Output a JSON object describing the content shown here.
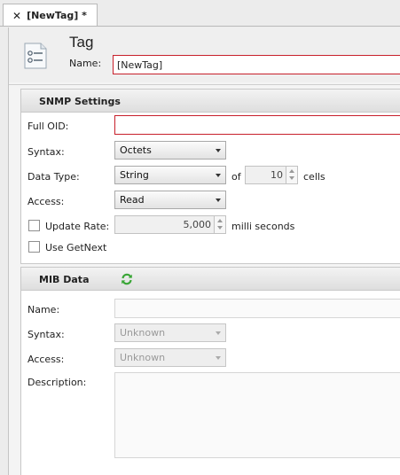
{
  "tab": {
    "close_glyph": "✕",
    "title": "[NewTag] *"
  },
  "header": {
    "title": "Tag",
    "name_label": "Name:",
    "name_value": "[NewTag]",
    "icon": "tag-document-icon"
  },
  "snmp": {
    "title": "SNMP Settings",
    "full_oid_label": "Full OID:",
    "full_oid_value": "",
    "syntax_label": "Syntax:",
    "syntax_value": "Octets",
    "data_type_label": "Data Type:",
    "data_type_value": "String",
    "of_label": "of",
    "cells_value": "10",
    "cells_label": "cells",
    "access_label": "Access:",
    "access_value": "Read",
    "update_rate_label": "Update Rate:",
    "update_rate_value": "5,000",
    "update_rate_unit": "milli seconds",
    "use_getnext_label": "Use GetNext"
  },
  "mib": {
    "title": "MIB Data",
    "refresh_icon": "refresh-icon",
    "name_label": "Name:",
    "name_value": "",
    "syntax_label": "Syntax:",
    "syntax_value": "Unknown",
    "access_label": "Access:",
    "access_value": "Unknown",
    "description_label": "Description:",
    "description_value": ""
  },
  "colors": {
    "error_border": "#c7202b",
    "refresh_green": "#3aa637"
  }
}
